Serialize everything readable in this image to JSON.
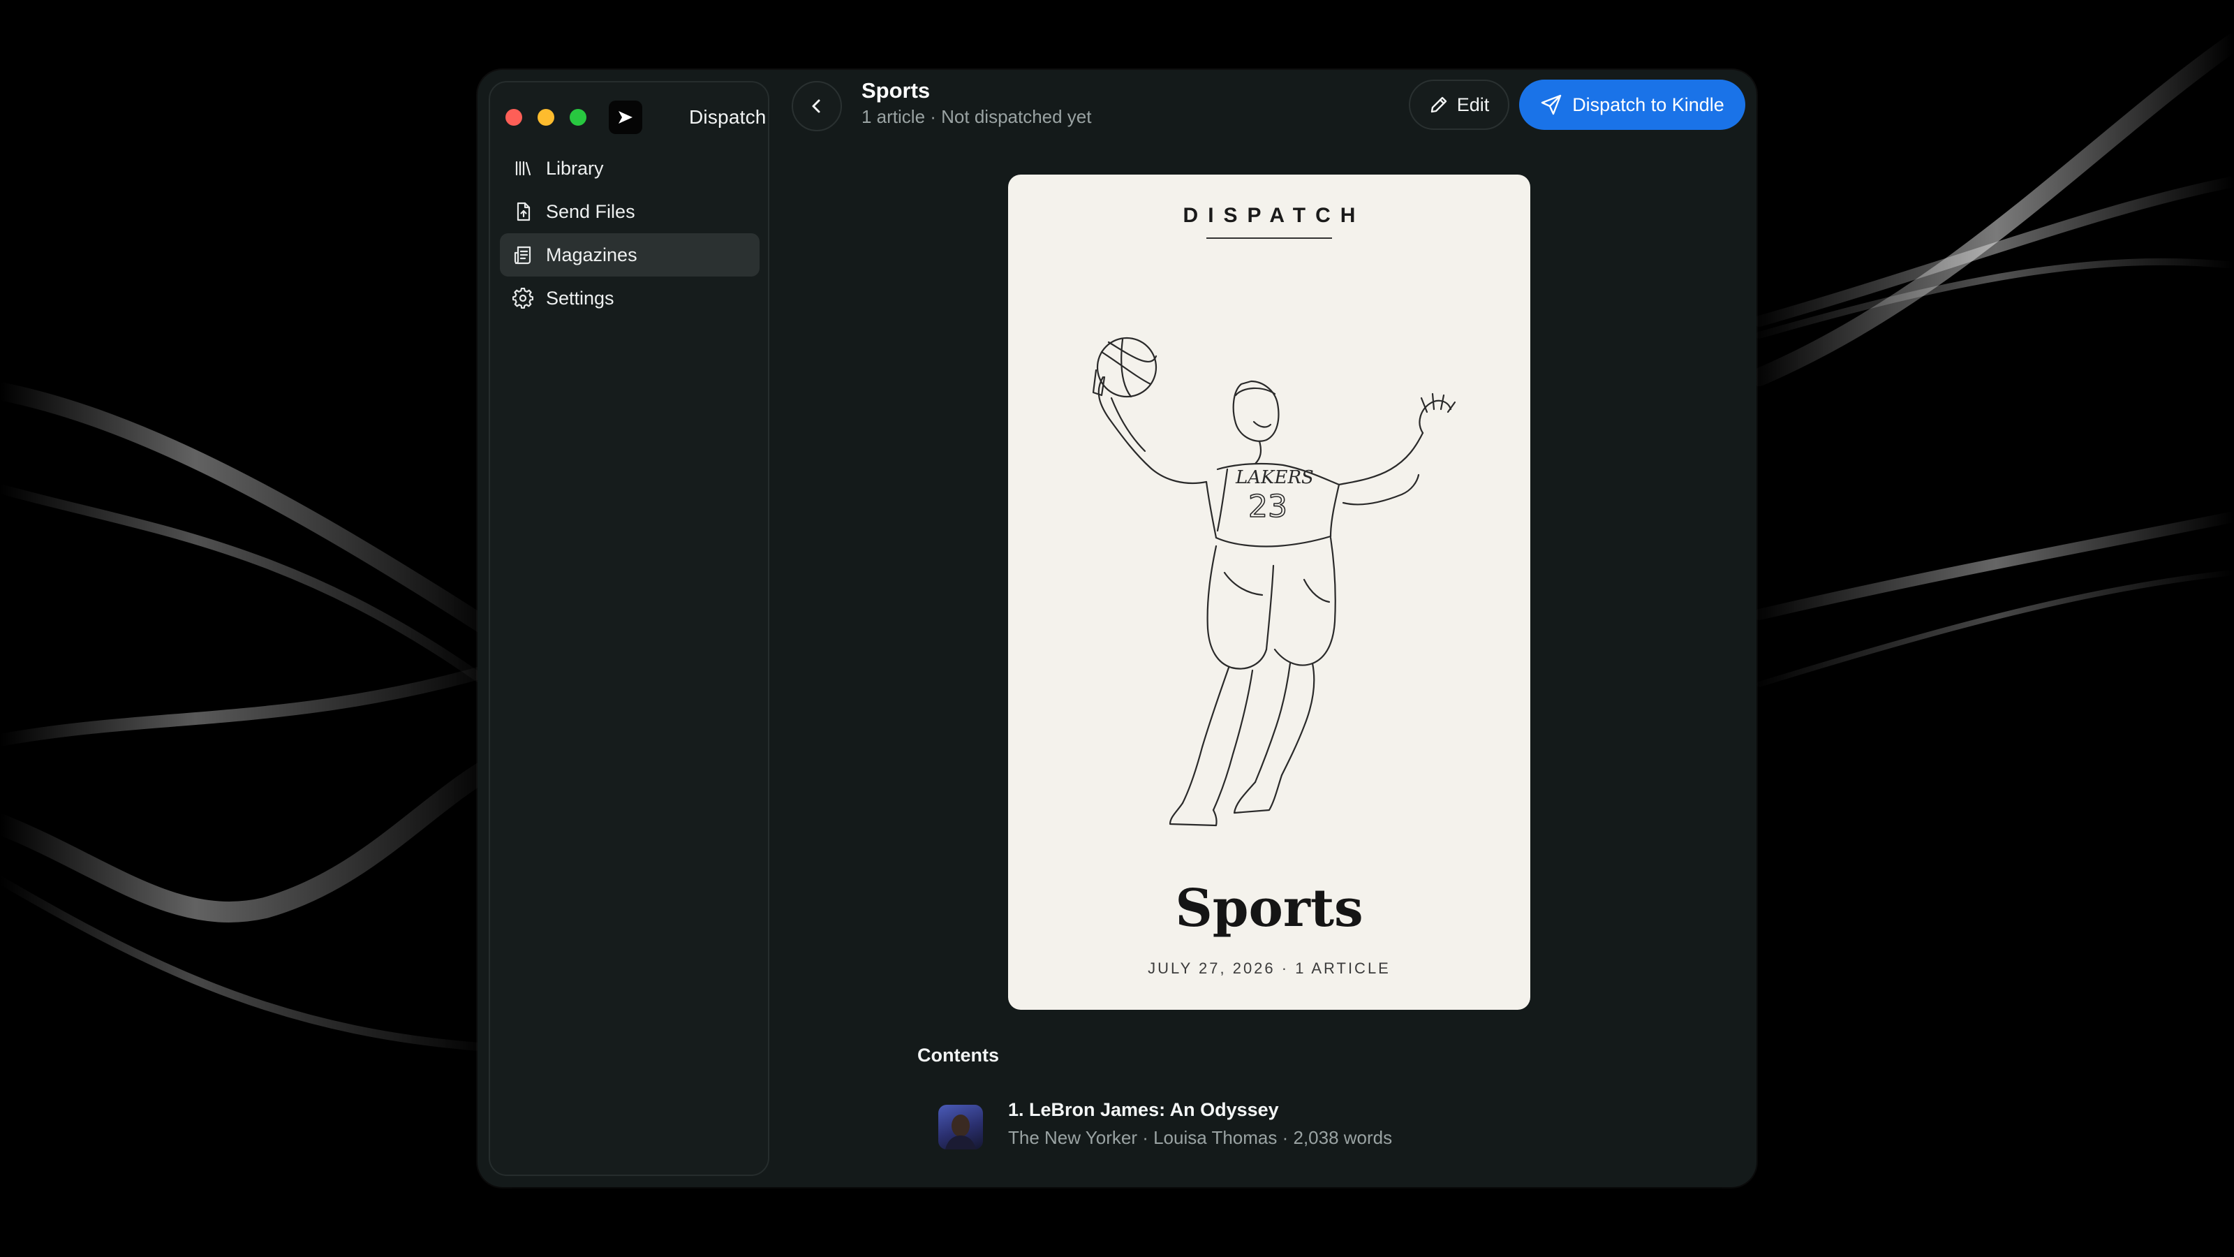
{
  "app": {
    "name": "Dispatch"
  },
  "sidebar": {
    "items": [
      {
        "label": "Library",
        "icon": "library-icon",
        "active": false
      },
      {
        "label": "Send Files",
        "icon": "send-file-icon",
        "active": false
      },
      {
        "label": "Magazines",
        "icon": "magazine-icon",
        "active": true
      },
      {
        "label": "Settings",
        "icon": "gear-icon",
        "active": false
      }
    ]
  },
  "header": {
    "title": "Sports",
    "subtitle": "1 article · Not dispatched yet",
    "edit_label": "Edit",
    "dispatch_label": "Dispatch to Kindle"
  },
  "cover": {
    "brand": "DISPATCH",
    "title": "Sports",
    "meta": "JULY 27, 2026 · 1 ARTICLE",
    "art": "basketball-player-line-drawing"
  },
  "contents": {
    "heading": "Contents",
    "articles": [
      {
        "title": "1. LeBron James: An Odyssey",
        "meta": "The New Yorker · Louisa Thomas · 2,038 words"
      }
    ]
  },
  "colors": {
    "accent": "#1a73e8",
    "window_bg": "#141a1a",
    "cover_bg": "#f4f2ec"
  }
}
